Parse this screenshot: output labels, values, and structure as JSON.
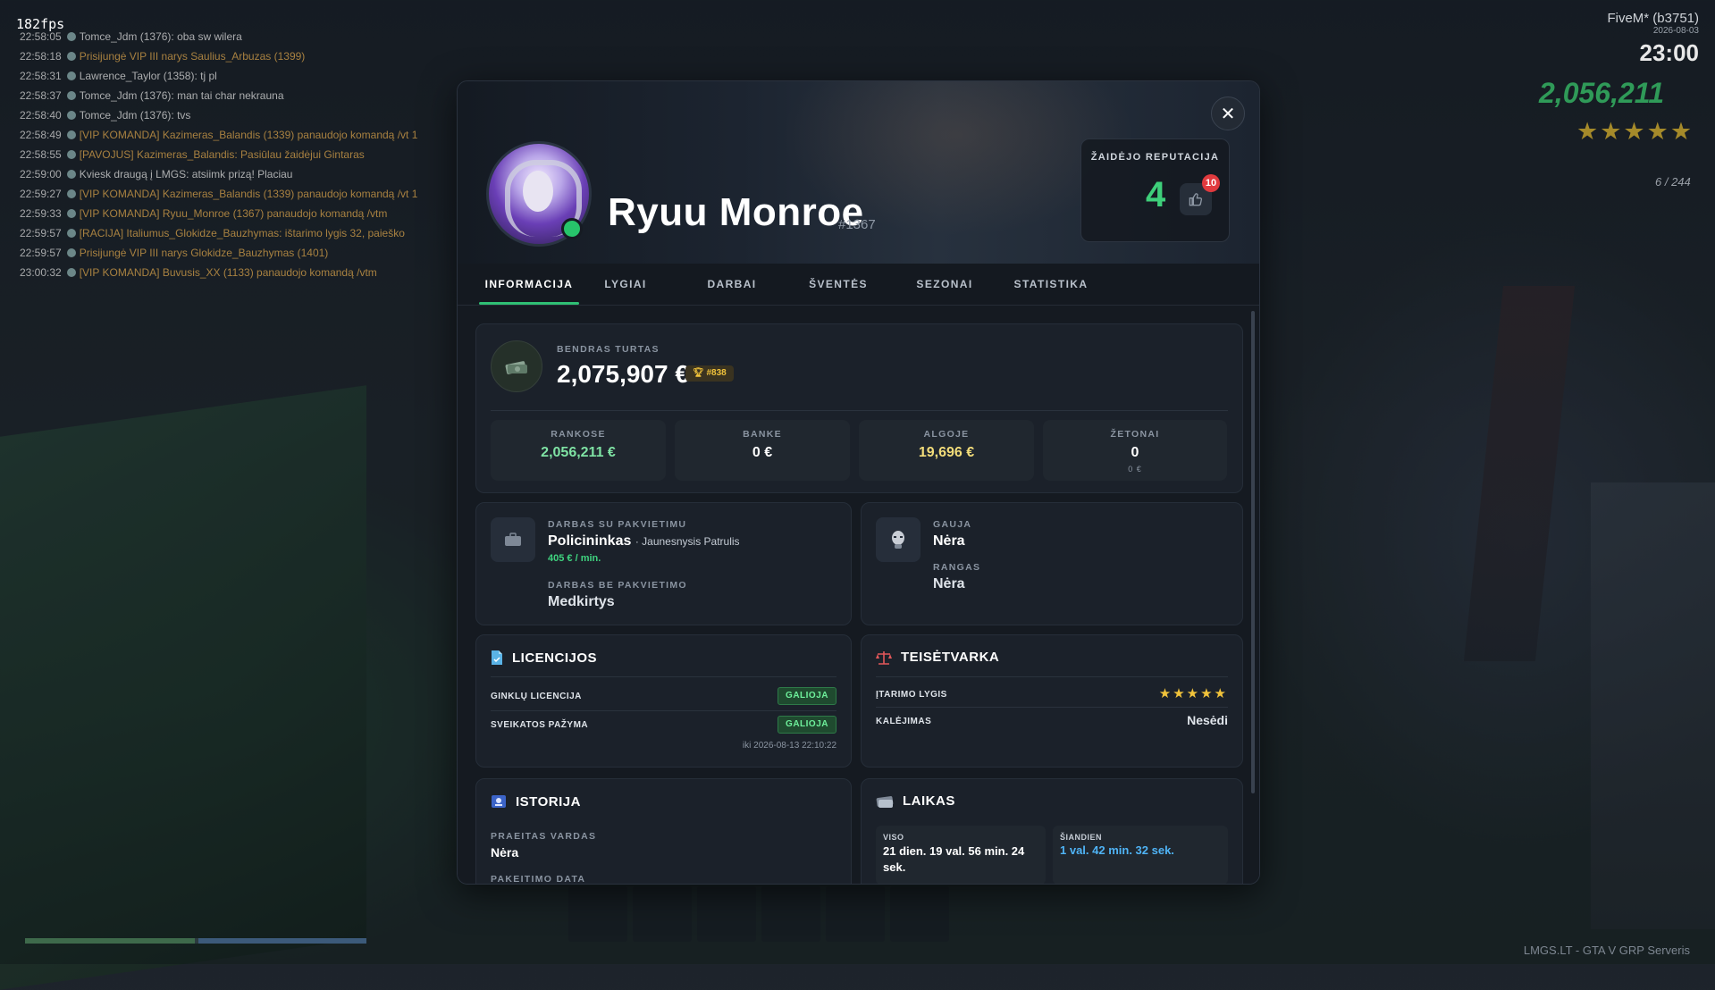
{
  "hud": {
    "fps": "182fps",
    "fivem": "FiveM* (b3751)",
    "date": "2026-08-03",
    "time": "23:00",
    "money": "2,056,211",
    "stars": "★★★★★",
    "ammo": "6 / 244",
    "server": "LMGS.LT - GTA V GRP Serveris"
  },
  "chat": [
    {
      "time": "22:58:05",
      "text": "Tomce_Jdm (1376): oba sw wilera"
    },
    {
      "time": "22:58:18",
      "text": "Prisijungė VIP III narys Saulius_Arbuzas (1399)"
    },
    {
      "time": "22:58:31",
      "text": "Lawrence_Taylor (1358): tj pl"
    },
    {
      "time": "22:58:37",
      "text": "Tomce_Jdm (1376): man tai char nekrauna"
    },
    {
      "time": "22:58:40",
      "text": "Tomce_Jdm (1376): tvs"
    },
    {
      "time": "22:58:49",
      "text": "[VIP KOMANDA] Kazimeras_Balandis (1339) panaudojo komandą /vt 1"
    },
    {
      "time": "22:58:55",
      "text": "[PAVOJUS] Kazimeras_Balandis: Pasiūlau žaidėjui Gintaras"
    },
    {
      "time": "22:59:00",
      "text": "Kviesk draugą į LMGS: atsiimk prizą! Placiau"
    },
    {
      "time": "22:59:27",
      "text": "[VIP KOMANDA] Kazimeras_Balandis (1339) panaudojo komandą /vt 1"
    },
    {
      "time": "22:59:33",
      "text": "[VIP KOMANDA] Ryuu_Monroe (1367) panaudojo komandą /vtm"
    },
    {
      "time": "22:59:57",
      "text": "[RACIJA] Italiumus_Glokidze_Bauzhymas: ištarimo lygis 32, paieško"
    },
    {
      "time": "22:59:57",
      "text": "Prisijungė VIP III narys Glokidze_Bauzhymas (1401)"
    },
    {
      "time": "23:00:32",
      "text": "[VIP KOMANDA] Buvusis_XX (1133) panaudojo komandą /vtm"
    }
  ],
  "profile": {
    "name": "Ryuu Monroe",
    "id": "#1367",
    "reputation_label": "ŽAIDĖJO REPUTACIJA",
    "reputation_value": "4",
    "likes_badge": "10"
  },
  "tabs": [
    {
      "label": "INFORMACIJA",
      "active": true
    },
    {
      "label": "LYGIAI"
    },
    {
      "label": "DARBAI"
    },
    {
      "label": "ŠVENTĖS"
    },
    {
      "label": "SEZONAI"
    },
    {
      "label": "STATISTIKA"
    }
  ],
  "wealth": {
    "label": "BENDRAS TURTAS",
    "total": "2,075,907 €",
    "rank": "#838",
    "subs": [
      {
        "label": "RANKOSE",
        "value": "2,056,211 €",
        "color": "#7fe3a4"
      },
      {
        "label": "BANKE",
        "value": "0 €",
        "color": "#ffffff"
      },
      {
        "label": "ALGOJE",
        "value": "19,696 €",
        "color": "#f3dd7a"
      },
      {
        "label": "ŽETONAI",
        "value": "0",
        "color": "#ffffff",
        "sub": "0 €"
      }
    ]
  },
  "jobs": {
    "with_invite_label": "DARBAS SU PAKVIETIMU",
    "job": "Policininkas",
    "rank": "· Jaunesnysis Patrulis",
    "salary": "405 € / min.",
    "without_invite_label": "DARBAS BE PAKVIETIMO",
    "job2": "Medkirtys"
  },
  "gang": {
    "gang_label": "GAUJA",
    "gang_value": "Nėra",
    "rank_label": "RANGAS",
    "rank_value": "Nėra"
  },
  "licenses": {
    "title": "LICENCIJOS",
    "items": [
      {
        "label": "GINKLŲ LICENCIJA",
        "status": "GALIOJA"
      },
      {
        "label": "SVEIKATOS PAŽYMA",
        "status": "GALIOJA"
      }
    ],
    "expires": "iki 2026-08-13 22:10:22"
  },
  "law": {
    "title": "TEISĖTVARKA",
    "suspicion_label": "ĮTARIMO LYGIS",
    "suspicion_stars": 5,
    "jail_label": "KALĖJIMAS",
    "jail_value": "Nesėdi"
  },
  "history": {
    "title": "ISTORIJA",
    "prev_name_label": "PRAEITAS VARDAS",
    "prev_name_value": "Nėra",
    "change_date_label": "PAKEITIMO DATA"
  },
  "time": {
    "title": "LAIKAS",
    "total_label": "VISO",
    "total_value": "21 dien. 19 val. 56 min. 24 sek.",
    "today_label": "ŠIANDIEN",
    "today_value": "1 val. 42 min. 32 sek."
  },
  "colors": {
    "accent": "#2fbf74",
    "badge": "#e03a3e",
    "gold": "#f1c33b"
  }
}
